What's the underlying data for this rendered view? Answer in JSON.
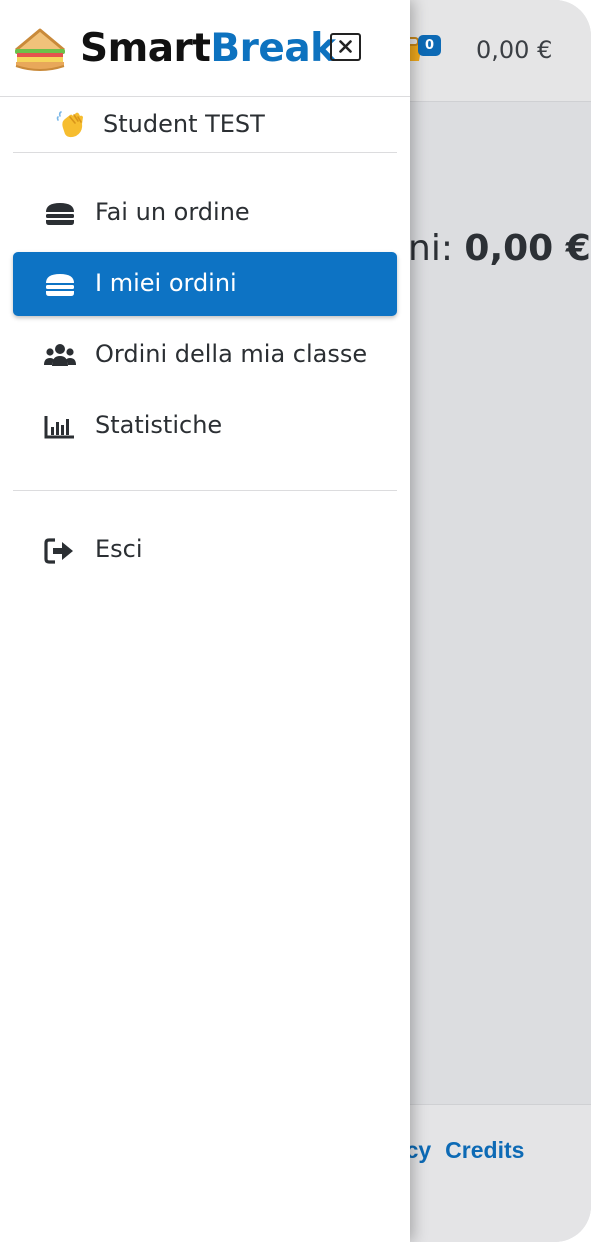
{
  "header": {
    "cart_count": "0",
    "balance": "0,00 €"
  },
  "main": {
    "total_partial_prefix": "ni: ",
    "total_partial_value": "0,00 €"
  },
  "footer": {
    "links": [
      "vacy",
      "Credits"
    ]
  },
  "drawer": {
    "brand_part1": "Smart",
    "brand_part2": "Break",
    "user": "Student TEST",
    "nav": [
      {
        "label": "Fai un ordine",
        "icon": "burger-icon"
      },
      {
        "label": "I miei ordini",
        "icon": "burger-icon",
        "active": true
      },
      {
        "label": "Ordini della mia classe",
        "icon": "users-icon"
      },
      {
        "label": "Statistiche",
        "icon": "chart-bar-icon"
      }
    ],
    "logout": {
      "label": "Esci",
      "icon": "sign-out-icon"
    }
  },
  "colors": {
    "accent": "#0d73c4",
    "brand_blue": "#0d72bf",
    "overlay_bg": "#dcdde0"
  }
}
